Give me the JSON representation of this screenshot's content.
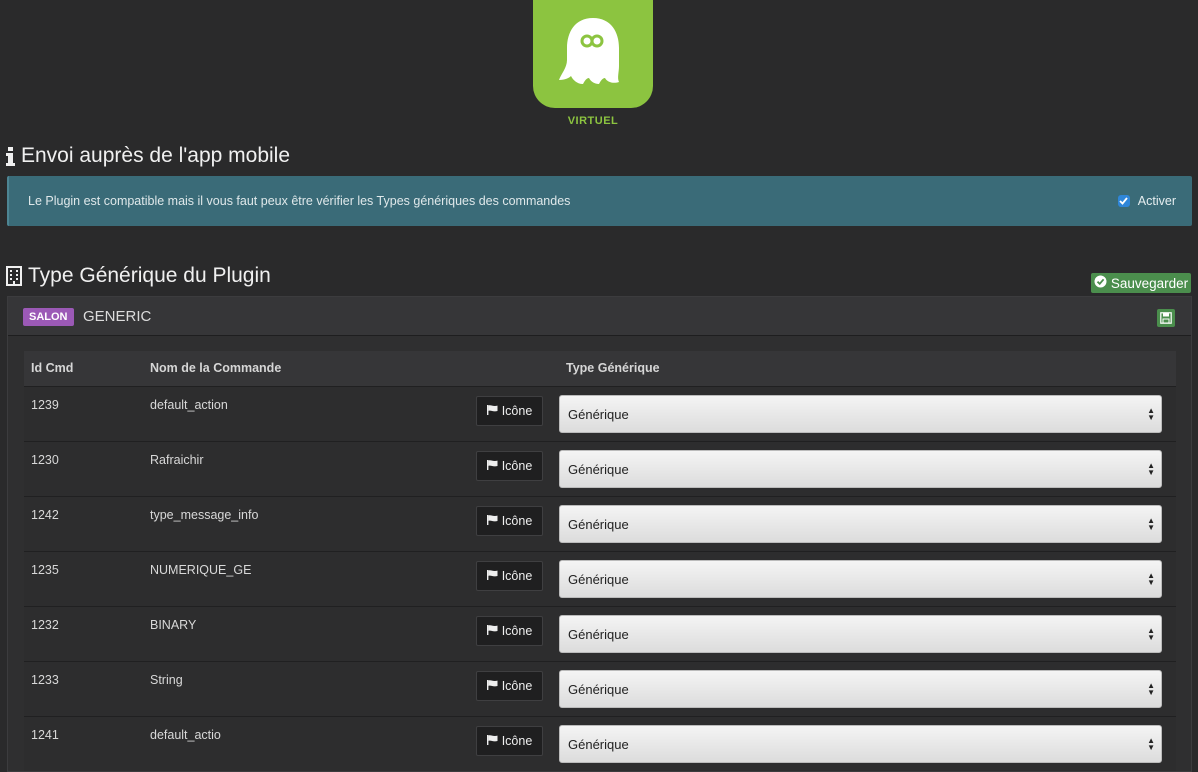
{
  "logo": {
    "label": "VIRTUEL"
  },
  "mobile_section": {
    "title": "Envoi auprès de l'app mobile",
    "alert_text": "Le Plugin est compatible mais il vous faut peux être vérifier les Types génériques des commandes",
    "activate_label": "Activer",
    "activate_checked": true
  },
  "generic_section": {
    "title": "Type Générique du Plugin",
    "save_label": "Sauvegarder"
  },
  "panel": {
    "badge": "SALON",
    "name": "GENERIC",
    "columns": [
      "Id Cmd",
      "Nom de la Commande",
      "Type Générique"
    ],
    "icon_button_label": "Icône",
    "rows": [
      {
        "id": "1239",
        "name": "default_action",
        "type": "Générique"
      },
      {
        "id": "1230",
        "name": "Rafraichir",
        "type": "Générique"
      },
      {
        "id": "1242",
        "name": "type_message_info",
        "type": "Générique"
      },
      {
        "id": "1235",
        "name": "NUMERIQUE_GE",
        "type": "Générique"
      },
      {
        "id": "1232",
        "name": "BINARY",
        "type": "Générique"
      },
      {
        "id": "1233",
        "name": "String",
        "type": "Générique"
      },
      {
        "id": "1241",
        "name": "default_actio",
        "type": "Générique"
      }
    ]
  },
  "colors": {
    "accent_green": "#8cc440",
    "alert_bg": "#3a6b78",
    "save_green": "#4b8e4d",
    "badge_purple": "#9b59b6"
  },
  "icons": [
    "ghost-logo-icon",
    "info-icon",
    "building-icon",
    "check-circle-icon",
    "floppy-disk-icon",
    "flag-icon",
    "sort-arrows-icon"
  ]
}
